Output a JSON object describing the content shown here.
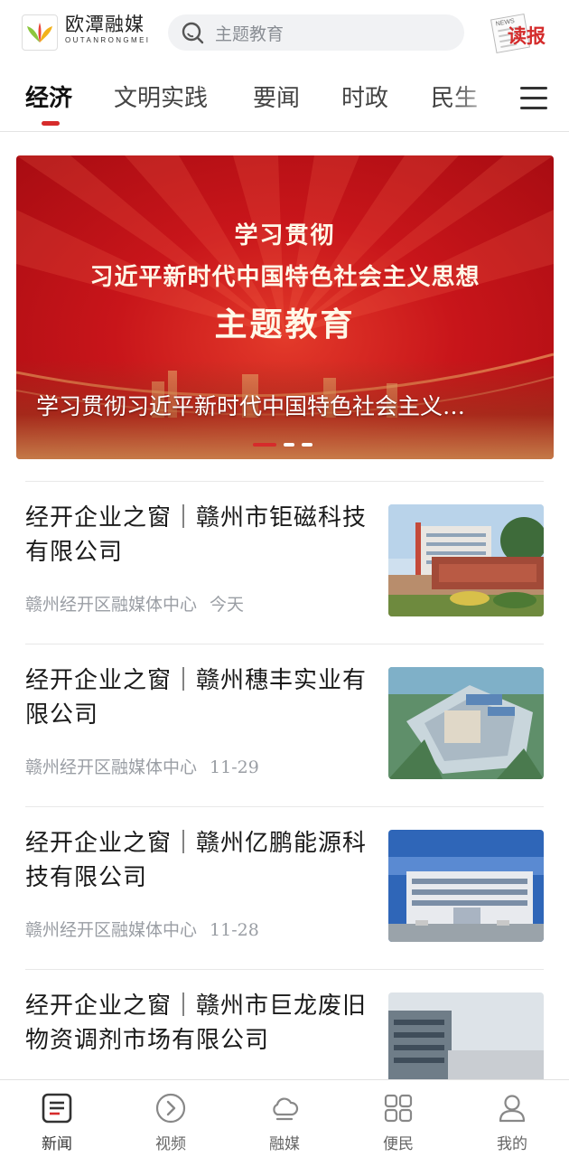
{
  "header": {
    "brand_cn": "欧潭融媒",
    "brand_en": "OUTANRONGMEI",
    "search_placeholder": "主题教育",
    "read_label": "读报",
    "read_sub": "NEWS"
  },
  "tabs": [
    {
      "label": "经济",
      "active": true
    },
    {
      "label": "文明实践",
      "active": false
    },
    {
      "label": "要闻",
      "active": false
    },
    {
      "label": "时政",
      "active": false
    },
    {
      "label": "民生",
      "active": false
    }
  ],
  "banner": {
    "line1": "学习贯彻",
    "line2": "习近平新时代中国特色社会主义思想",
    "line3": "主题教育",
    "caption": "学习贯彻习近平新时代中国特色社会主义…",
    "slide_count": 3,
    "active_slide": 1
  },
  "news": [
    {
      "title": "经开企业之窗｜赣州市钜磁科技有限公司",
      "source": "赣州经开区融媒体中心",
      "date": "今天",
      "image": "building-with-gate-sign"
    },
    {
      "title": "经开企业之窗｜赣州穗丰实业有限公司",
      "source": "赣州经开区融媒体中心",
      "date": "11-29",
      "image": "aerial-factory-render"
    },
    {
      "title": "经开企业之窗｜赣州亿鹏能源科技有限公司",
      "source": "赣州经开区融媒体中心",
      "date": "11-28",
      "image": "office-building"
    },
    {
      "title": "经开企业之窗｜赣州市巨龙废旧物资调剂市场有限公司",
      "source": "",
      "date": "",
      "image": "industrial-warehouse"
    }
  ],
  "bottom_nav": [
    {
      "label": "新闻",
      "icon": "news-icon",
      "active": true
    },
    {
      "label": "视频",
      "icon": "video-icon",
      "active": false
    },
    {
      "label": "融媒",
      "icon": "cloud-icon",
      "active": false
    },
    {
      "label": "便民",
      "icon": "grid-icon",
      "active": false
    },
    {
      "label": "我的",
      "icon": "user-icon",
      "active": false
    }
  ],
  "colors": {
    "accent": "#d62b2b",
    "banner_red": "#c8151a",
    "meta_gray": "#9a9ea4"
  }
}
